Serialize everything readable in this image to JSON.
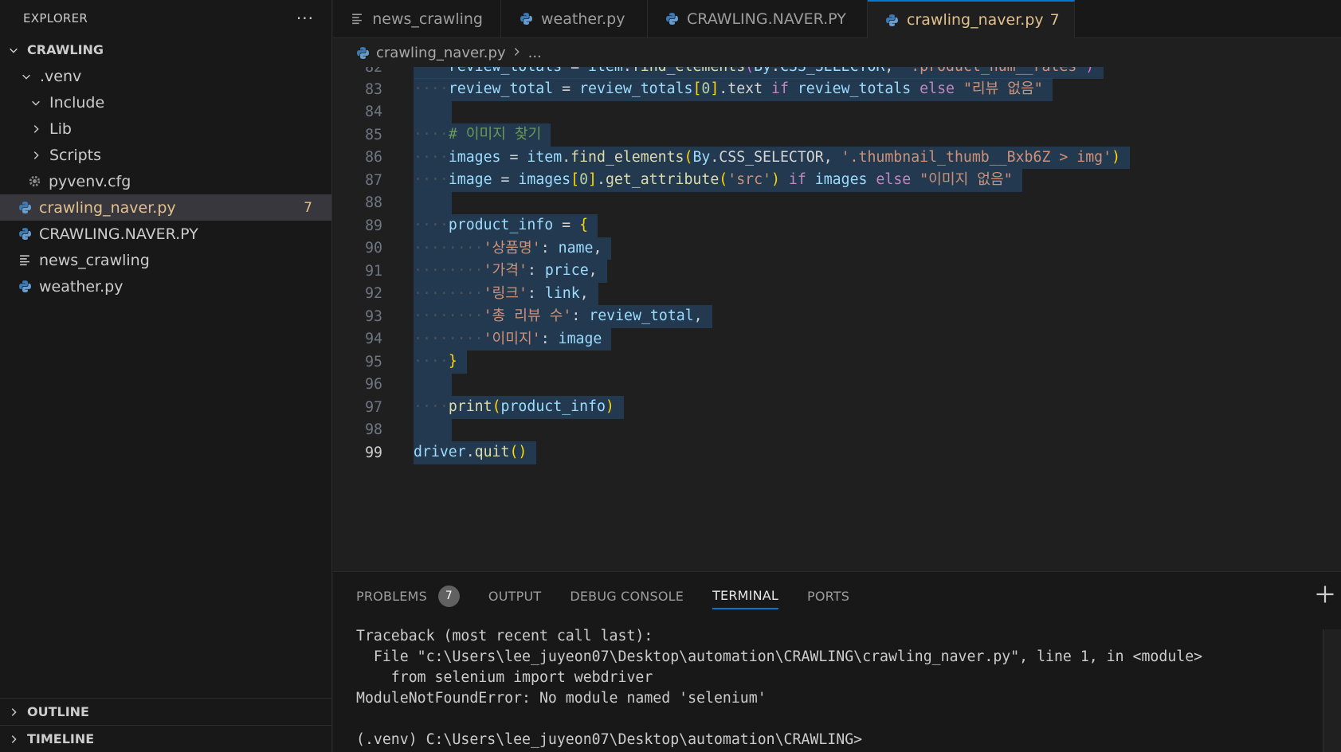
{
  "sidebar": {
    "title": "EXPLORER",
    "more_label": "···",
    "root": "CRAWLING",
    "items": [
      {
        "label": ".venv"
      },
      {
        "label": "Include"
      },
      {
        "label": "Lib"
      },
      {
        "label": "Scripts"
      },
      {
        "label": "pyvenv.cfg"
      },
      {
        "label": "crawling_naver.py",
        "badge": "7"
      },
      {
        "label": "CRAWLING.NAVER.PY"
      },
      {
        "label": "news_crawling"
      },
      {
        "label": "weather.py"
      }
    ],
    "outline_label": "OUTLINE",
    "timeline_label": "TIMELINE"
  },
  "tabs": [
    {
      "label": "news_crawling",
      "icon": "text-file-icon"
    },
    {
      "label": "weather.py",
      "icon": "python-icon"
    },
    {
      "label": "CRAWLING.NAVER.PY",
      "icon": "python-icon",
      "modified": true
    },
    {
      "label": "crawling_naver.py",
      "icon": "python-icon",
      "count": "7",
      "modified": true,
      "active": true
    }
  ],
  "breadcrumb": {
    "file": "crawling_naver.py",
    "more": "..."
  },
  "editor": {
    "partial_top_line": "review_totals = item.find_elements(By.CSS_SELECTOR, '.product_num__rates')",
    "line_numbers": [
      "83",
      "84",
      "85",
      "86",
      "87",
      "88",
      "89",
      "90",
      "91",
      "92",
      "93",
      "94",
      "95",
      "96",
      "97",
      "98",
      "99"
    ],
    "current_line": "99"
  },
  "panel": {
    "tabs": [
      "PROBLEMS",
      "OUTPUT",
      "DEBUG CONSOLE",
      "TERMINAL",
      "PORTS"
    ],
    "problems_count": "7",
    "active_tab": "TERMINAL",
    "terminal_lines": [
      "Traceback (most recent call last):",
      "  File \"c:\\Users\\lee_juyeon07\\Desktop\\automation\\CRAWLING\\crawling_naver.py\", line 1, in <module>",
      "    from selenium import webdriver",
      "ModuleNotFoundError: No module named 'selenium'",
      "",
      "(.venv) C:\\Users\\lee_juyeon07\\Desktop\\automation\\CRAWLING>"
    ]
  },
  "colors": {
    "accent": "#0078d4",
    "modified": "#e2c08d",
    "selection": "#264f78",
    "background": "#1f1f1f"
  }
}
